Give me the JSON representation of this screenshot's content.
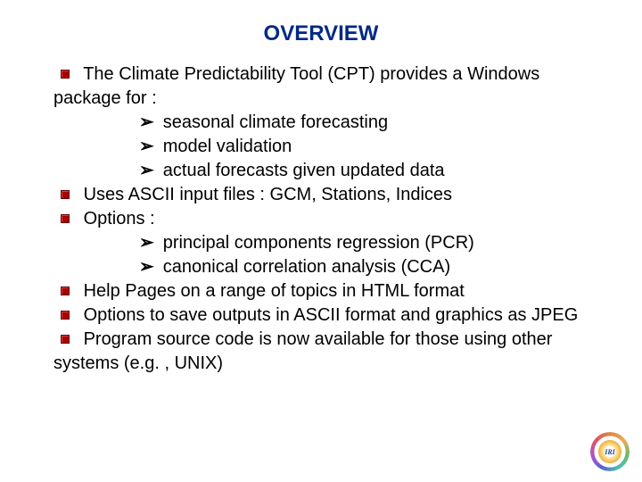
{
  "title": "OVERVIEW",
  "items": {
    "b1": "The Climate Predictability Tool (CPT) provides a Windows package for :",
    "b1_subs": {
      "s1": "seasonal climate forecasting",
      "s2": "model validation",
      "s3": "actual forecasts given updated data"
    },
    "b2": "Uses ASCII input files : GCM, Stations, Indices",
    "b3": "Options :",
    "b3_subs": {
      "s1": "principal components regression (PCR)",
      "s2": "canonical correlation analysis (CCA)"
    },
    "b4": "Help Pages on a range of topics in HTML format",
    "b5": "Options to save outputs in ASCII format and graphics as JPEG",
    "b6": "Program source code is now available for those using other systems (e.g. , UNIX)"
  },
  "logo_label": "IRI"
}
